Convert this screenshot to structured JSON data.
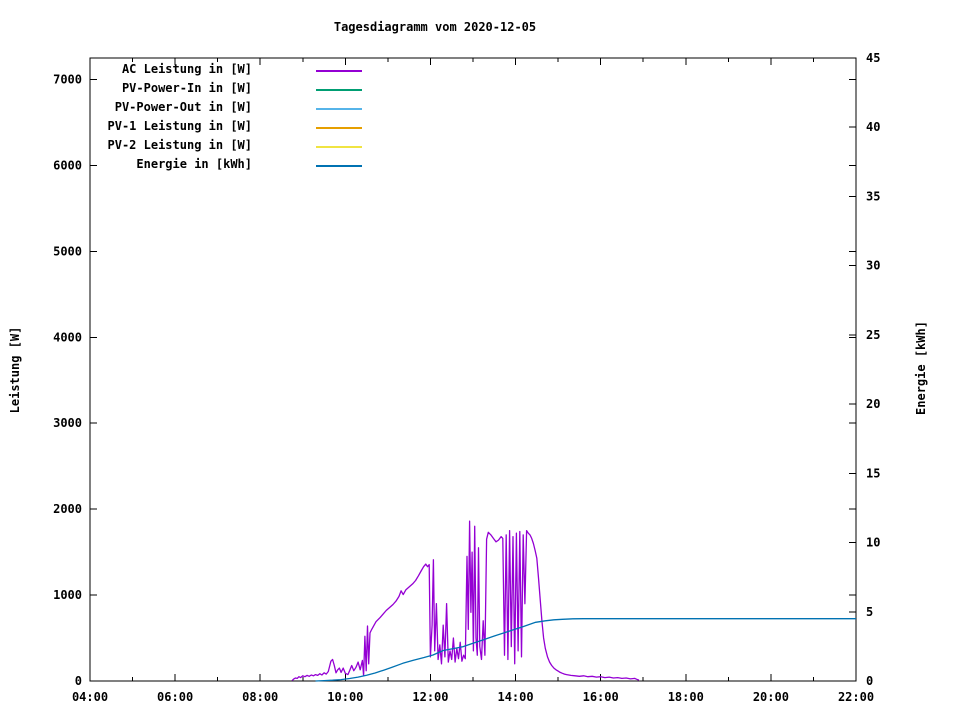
{
  "title": "Tagesdiagramm vom 2020-12-05",
  "axes": {
    "y1_label": "Leistung [W]",
    "y2_label": "Energie [kWh]"
  },
  "colors": {
    "background": "#ffffff",
    "axis": "#000000",
    "ac": "#9400D3",
    "pv_in": "#009E73",
    "pv_out": "#56B4E9",
    "pv1": "#E69F00",
    "pv2": "#F0E442",
    "energie": "#0072B2"
  },
  "chart_data": {
    "type": "line",
    "title": "Tagesdiagramm vom 2020-12-05",
    "xlabel": "",
    "ylabel": "Leistung [W]",
    "y2label": "Energie [kWh]",
    "xlim": [
      4,
      22
    ],
    "ylim": [
      0,
      7250
    ],
    "y2lim": [
      0,
      45
    ],
    "grid": false,
    "legend_position": "top-left",
    "x_ticks": [
      {
        "v": 4,
        "label": "04:00"
      },
      {
        "v": 6,
        "label": "06:00"
      },
      {
        "v": 8,
        "label": "08:00"
      },
      {
        "v": 10,
        "label": "10:00"
      },
      {
        "v": 12,
        "label": "12:00"
      },
      {
        "v": 14,
        "label": "14:00"
      },
      {
        "v": 16,
        "label": "16:00"
      },
      {
        "v": 18,
        "label": "18:00"
      },
      {
        "v": 20,
        "label": "20:00"
      },
      {
        "v": 22,
        "label": "22:00"
      }
    ],
    "x_minor_ticks": [
      5,
      7,
      9,
      11,
      13,
      15,
      17,
      19,
      21
    ],
    "y_ticks": [
      {
        "v": 0,
        "label": "0"
      },
      {
        "v": 1000,
        "label": "1000"
      },
      {
        "v": 2000,
        "label": "2000"
      },
      {
        "v": 3000,
        "label": "3000"
      },
      {
        "v": 4000,
        "label": "4000"
      },
      {
        "v": 5000,
        "label": "5000"
      },
      {
        "v": 6000,
        "label": "6000"
      },
      {
        "v": 7000,
        "label": "7000"
      }
    ],
    "y2_ticks": [
      {
        "v": 0,
        "label": "0"
      },
      {
        "v": 5,
        "label": "5"
      },
      {
        "v": 10,
        "label": "10"
      },
      {
        "v": 15,
        "label": "15"
      },
      {
        "v": 20,
        "label": "20"
      },
      {
        "v": 25,
        "label": "25"
      },
      {
        "v": 30,
        "label": "30"
      },
      {
        "v": 35,
        "label": "35"
      },
      {
        "v": 40,
        "label": "40"
      },
      {
        "v": 45,
        "label": "45"
      }
    ],
    "series": [
      {
        "name": "AC Leistung in [W]",
        "color": "#9400D3",
        "axis": "y1",
        "points": [
          [
            8.75,
            5
          ],
          [
            8.79,
            25
          ],
          [
            8.83,
            35
          ],
          [
            8.87,
            30
          ],
          [
            8.91,
            50
          ],
          [
            8.95,
            40
          ],
          [
            9.0,
            60
          ],
          [
            9.05,
            50
          ],
          [
            9.1,
            65
          ],
          [
            9.15,
            55
          ],
          [
            9.2,
            70
          ],
          [
            9.25,
            60
          ],
          [
            9.3,
            75
          ],
          [
            9.35,
            65
          ],
          [
            9.4,
            85
          ],
          [
            9.45,
            70
          ],
          [
            9.5,
            95
          ],
          [
            9.55,
            80
          ],
          [
            9.6,
            110
          ],
          [
            9.63,
            170
          ],
          [
            9.66,
            230
          ],
          [
            9.7,
            250
          ],
          [
            9.74,
            180
          ],
          [
            9.78,
            95
          ],
          [
            9.82,
            130
          ],
          [
            9.86,
            150
          ],
          [
            9.9,
            100
          ],
          [
            9.95,
            150
          ],
          [
            10.0,
            90
          ],
          [
            10.06,
            75
          ],
          [
            10.1,
            120
          ],
          [
            10.15,
            180
          ],
          [
            10.2,
            120
          ],
          [
            10.25,
            160
          ],
          [
            10.3,
            220
          ],
          [
            10.35,
            130
          ],
          [
            10.4,
            240
          ],
          [
            10.43,
            60
          ],
          [
            10.46,
            520
          ],
          [
            10.49,
            120
          ],
          [
            10.52,
            640
          ],
          [
            10.55,
            200
          ],
          [
            10.58,
            560
          ],
          [
            10.62,
            600
          ],
          [
            10.72,
            690
          ],
          [
            10.82,
            740
          ],
          [
            10.88,
            775
          ],
          [
            10.96,
            820
          ],
          [
            11.04,
            855
          ],
          [
            11.12,
            890
          ],
          [
            11.19,
            930
          ],
          [
            11.26,
            985
          ],
          [
            11.31,
            1050
          ],
          [
            11.36,
            1005
          ],
          [
            11.42,
            1060
          ],
          [
            11.5,
            1095
          ],
          [
            11.58,
            1130
          ],
          [
            11.65,
            1170
          ],
          [
            11.72,
            1225
          ],
          [
            11.78,
            1280
          ],
          [
            11.84,
            1330
          ],
          [
            11.89,
            1360
          ],
          [
            11.93,
            1330
          ],
          [
            11.97,
            1355
          ],
          [
            12.0,
            280
          ],
          [
            12.04,
            650
          ],
          [
            12.07,
            1410
          ],
          [
            12.1,
            350
          ],
          [
            12.14,
            900
          ],
          [
            12.18,
            250
          ],
          [
            12.22,
            420
          ],
          [
            12.26,
            200
          ],
          [
            12.3,
            650
          ],
          [
            12.34,
            280
          ],
          [
            12.38,
            900
          ],
          [
            12.42,
            220
          ],
          [
            12.46,
            350
          ],
          [
            12.5,
            250
          ],
          [
            12.54,
            500
          ],
          [
            12.58,
            220
          ],
          [
            12.62,
            380
          ],
          [
            12.66,
            260
          ],
          [
            12.7,
            450
          ],
          [
            12.74,
            230
          ],
          [
            12.78,
            300
          ],
          [
            12.82,
            260
          ],
          [
            12.86,
            1450
          ],
          [
            12.89,
            600
          ],
          [
            12.92,
            1860
          ],
          [
            12.95,
            800
          ],
          [
            12.98,
            1500
          ],
          [
            13.01,
            350
          ],
          [
            13.04,
            1800
          ],
          [
            13.07,
            500
          ],
          [
            13.1,
            300
          ],
          [
            13.13,
            1550
          ],
          [
            13.16,
            400
          ],
          [
            13.2,
            250
          ],
          [
            13.24,
            700
          ],
          [
            13.28,
            300
          ],
          [
            13.32,
            1650
          ],
          [
            13.36,
            1730
          ],
          [
            13.42,
            1700
          ],
          [
            13.48,
            1660
          ],
          [
            13.54,
            1620
          ],
          [
            13.6,
            1640
          ],
          [
            13.66,
            1680
          ],
          [
            13.7,
            1660
          ],
          [
            13.74,
            300
          ],
          [
            13.78,
            1700
          ],
          [
            13.82,
            250
          ],
          [
            13.86,
            1750
          ],
          [
            13.9,
            400
          ],
          [
            13.94,
            1680
          ],
          [
            13.98,
            200
          ],
          [
            14.02,
            1720
          ],
          [
            14.06,
            350
          ],
          [
            14.1,
            1740
          ],
          [
            14.14,
            280
          ],
          [
            14.18,
            1700
          ],
          [
            14.22,
            900
          ],
          [
            14.26,
            1750
          ],
          [
            14.3,
            1720
          ],
          [
            14.34,
            1700
          ],
          [
            14.38,
            1660
          ],
          [
            14.42,
            1600
          ],
          [
            14.46,
            1520
          ],
          [
            14.5,
            1430
          ],
          [
            14.54,
            1200
          ],
          [
            14.58,
            950
          ],
          [
            14.62,
            700
          ],
          [
            14.66,
            500
          ],
          [
            14.7,
            380
          ],
          [
            14.75,
            280
          ],
          [
            14.8,
            220
          ],
          [
            14.85,
            180
          ],
          [
            14.9,
            150
          ],
          [
            14.95,
            130
          ],
          [
            15.0,
            115
          ],
          [
            15.05,
            100
          ],
          [
            15.1,
            90
          ],
          [
            15.15,
            80
          ],
          [
            15.2,
            75
          ],
          [
            15.3,
            65
          ],
          [
            15.4,
            60
          ],
          [
            15.5,
            55
          ],
          [
            15.6,
            60
          ],
          [
            15.7,
            50
          ],
          [
            15.8,
            55
          ],
          [
            15.9,
            45
          ],
          [
            16.0,
            50
          ],
          [
            16.1,
            40
          ],
          [
            16.2,
            45
          ],
          [
            16.3,
            35
          ],
          [
            16.4,
            40
          ],
          [
            16.5,
            30
          ],
          [
            16.6,
            35
          ],
          [
            16.7,
            25
          ],
          [
            16.8,
            30
          ],
          [
            16.85,
            20
          ],
          [
            16.9,
            10
          ]
        ]
      },
      {
        "name": "PV-Power-In in [W]",
        "color": "#009E73",
        "axis": "y1",
        "points": []
      },
      {
        "name": "PV-Power-Out in [W]",
        "color": "#56B4E9",
        "axis": "y1",
        "points": []
      },
      {
        "name": "PV-1 Leistung in [W]",
        "color": "#E69F00",
        "axis": "y1",
        "points": []
      },
      {
        "name": "PV-2 Leistung in [W]",
        "color": "#F0E442",
        "axis": "y1",
        "points": []
      },
      {
        "name": "Energie in [kWh]",
        "color": "#0072B2",
        "axis": "y2",
        "points": [
          [
            9.3,
            0
          ],
          [
            9.5,
            0.03
          ],
          [
            9.7,
            0.06
          ],
          [
            9.9,
            0.1
          ],
          [
            10.1,
            0.18
          ],
          [
            10.3,
            0.28
          ],
          [
            10.5,
            0.42
          ],
          [
            10.7,
            0.58
          ],
          [
            10.9,
            0.78
          ],
          [
            11.1,
            1.0
          ],
          [
            11.35,
            1.28
          ],
          [
            11.6,
            1.5
          ],
          [
            11.85,
            1.7
          ],
          [
            12.06,
            1.88
          ],
          [
            12.3,
            2.2
          ],
          [
            12.55,
            2.35
          ],
          [
            12.76,
            2.48
          ],
          [
            13.0,
            2.72
          ],
          [
            13.23,
            2.96
          ],
          [
            13.45,
            3.2
          ],
          [
            13.7,
            3.45
          ],
          [
            13.95,
            3.7
          ],
          [
            14.17,
            3.92
          ],
          [
            14.47,
            4.24
          ],
          [
            14.7,
            4.35
          ],
          [
            14.9,
            4.42
          ],
          [
            15.1,
            4.46
          ],
          [
            15.35,
            4.49
          ],
          [
            15.6,
            4.5
          ],
          [
            16.5,
            4.5
          ],
          [
            18.0,
            4.5
          ],
          [
            20.0,
            4.5
          ],
          [
            22.0,
            4.5
          ]
        ]
      }
    ]
  }
}
